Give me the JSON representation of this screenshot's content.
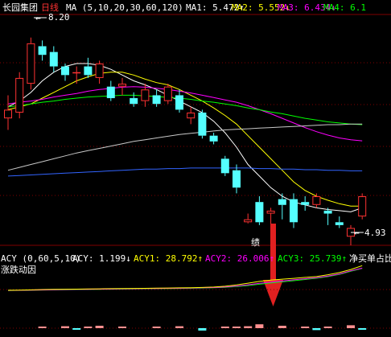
{
  "stock_name": "长园集团",
  "period": "日线",
  "main": {
    "indicator": "MA (5,10,20,30,60,120)",
    "ma_items": [
      {
        "label": "MA1:",
        "value": "5.472",
        "arrow": "↑",
        "color": "#ffffff"
      },
      {
        "label": "MA2:",
        "value": "5.552",
        "arrow": "↓",
        "color": "#ffff00"
      },
      {
        "label": "MA3:",
        "value": "6.434",
        "arrow": "↓",
        "color": "#ff00ff"
      },
      {
        "label": "MA4:",
        "value": "6.1",
        "arrow": "",
        "color": "#00ff00"
      }
    ],
    "high_label": "8.20",
    "low_label": "4.93"
  },
  "sub": {
    "indicator": "ACY (0,60,5,10)",
    "acy_items": [
      {
        "label": "ACY:",
        "value": "1.199",
        "arrow": "↓",
        "color": "#ffffff"
      },
      {
        "label": "ACY1:",
        "value": "28.792",
        "arrow": "↑",
        "color": "#ffff00"
      },
      {
        "label": "ACY2:",
        "value": "26.006",
        "arrow": "↑",
        "color": "#ff00ff"
      },
      {
        "label": "ACY3:",
        "value": "25.739",
        "arrow": "↑",
        "color": "#00ff00"
      }
    ],
    "extra_label": "净买单占比",
    "second_line": "涨跌动因"
  },
  "annotation": "绩",
  "colors": {
    "up": "#ff3232",
    "down": "#54ffff",
    "grid": "#800000",
    "ma5": "#ffffff",
    "ma10": "#ffff00",
    "ma20": "#ff00ff",
    "ma30": "#00ff00",
    "ma60": "#c8c8c8",
    "ma120": "#3264ff",
    "arrow": "#e02020"
  },
  "chart_data": {
    "type": "candlestick",
    "price_range": [
      4.6,
      8.6
    ],
    "candles": [
      {
        "o": 6.8,
        "h": 7.2,
        "l": 6.6,
        "c": 6.95
      },
      {
        "o": 6.9,
        "h": 7.6,
        "l": 6.8,
        "c": 7.5
      },
      {
        "o": 7.4,
        "h": 8.2,
        "l": 7.3,
        "c": 8.1
      },
      {
        "o": 8.05,
        "h": 8.15,
        "l": 7.8,
        "c": 7.9
      },
      {
        "o": 7.95,
        "h": 8.05,
        "l": 7.6,
        "c": 7.7
      },
      {
        "o": 7.7,
        "h": 7.75,
        "l": 7.45,
        "c": 7.55
      },
      {
        "o": 7.6,
        "h": 7.7,
        "l": 7.4,
        "c": 7.6
      },
      {
        "o": 7.7,
        "h": 7.85,
        "l": 7.5,
        "c": 7.55
      },
      {
        "o": 7.5,
        "h": 7.8,
        "l": 7.4,
        "c": 7.75
      },
      {
        "o": 7.35,
        "h": 7.45,
        "l": 7.1,
        "c": 7.15
      },
      {
        "o": 7.35,
        "h": 7.5,
        "l": 7.2,
        "c": 7.4
      },
      {
        "o": 7.15,
        "h": 7.25,
        "l": 7.0,
        "c": 7.05
      },
      {
        "o": 7.1,
        "h": 7.4,
        "l": 7.0,
        "c": 7.3
      },
      {
        "o": 7.2,
        "h": 7.3,
        "l": 7.0,
        "c": 7.05
      },
      {
        "o": 7.1,
        "h": 7.4,
        "l": 7.05,
        "c": 7.35
      },
      {
        "o": 7.2,
        "h": 7.3,
        "l": 6.9,
        "c": 6.95
      },
      {
        "o": 6.8,
        "h": 7.0,
        "l": 6.7,
        "c": 6.9
      },
      {
        "o": 6.9,
        "h": 6.95,
        "l": 6.45,
        "c": 6.5
      },
      {
        "o": 6.5,
        "h": 6.55,
        "l": 6.35,
        "c": 6.4
      },
      {
        "o": 6.1,
        "h": 6.15,
        "l": 5.8,
        "c": 5.85
      },
      {
        "o": 5.9,
        "h": 6.0,
        "l": 5.5,
        "c": 5.6
      },
      {
        "o": 5.0,
        "h": 5.15,
        "l": 4.98,
        "c": 5.05
      },
      {
        "o": 5.35,
        "h": 5.45,
        "l": 4.95,
        "c": 5.0
      },
      {
        "o": 5.15,
        "h": 5.25,
        "l": 4.95,
        "c": 5.2
      },
      {
        "o": 5.4,
        "h": 5.5,
        "l": 5.05,
        "c": 5.3
      },
      {
        "o": 5.4,
        "h": 5.5,
        "l": 4.9,
        "c": 5.0
      },
      {
        "o": 5.35,
        "h": 5.45,
        "l": 5.2,
        "c": 5.3
      },
      {
        "o": 5.3,
        "h": 5.5,
        "l": 5.25,
        "c": 5.45
      },
      {
        "o": 5.2,
        "h": 5.25,
        "l": 4.95,
        "c": 5.15
      },
      {
        "o": 5.0,
        "h": 5.1,
        "l": 4.9,
        "c": 4.95
      },
      {
        "o": 4.75,
        "h": 4.95,
        "l": 4.6,
        "c": 4.9
      },
      {
        "o": 5.1,
        "h": 5.5,
        "l": 5.05,
        "c": 5.45
      }
    ],
    "ma": {
      "ma5": [
        7.0,
        7.1,
        7.25,
        7.45,
        7.6,
        7.7,
        7.75,
        7.75,
        7.72,
        7.65,
        7.55,
        7.45,
        7.38,
        7.3,
        7.2,
        7.1,
        7.0,
        6.9,
        6.75,
        6.55,
        6.3,
        6.0,
        5.8,
        5.6,
        5.45,
        5.35,
        5.3,
        5.25,
        5.22,
        5.2,
        5.18,
        5.25
      ],
      "ma10": [
        6.95,
        7.0,
        7.05,
        7.15,
        7.25,
        7.35,
        7.45,
        7.52,
        7.58,
        7.6,
        7.6,
        7.55,
        7.48,
        7.42,
        7.38,
        7.3,
        7.2,
        7.1,
        6.98,
        6.85,
        6.7,
        6.5,
        6.3,
        6.1,
        5.9,
        5.7,
        5.55,
        5.45,
        5.38,
        5.32,
        5.28,
        5.28
      ],
      "ma20": [
        7.05,
        7.08,
        7.1,
        7.13,
        7.17,
        7.2,
        7.23,
        7.27,
        7.3,
        7.32,
        7.34,
        7.35,
        7.34,
        7.32,
        7.3,
        7.27,
        7.24,
        7.2,
        7.16,
        7.12,
        7.08,
        7.02,
        6.95,
        6.88,
        6.8,
        6.72,
        6.64,
        6.57,
        6.51,
        6.46,
        6.43,
        6.41
      ],
      "ma30": [
        7.0,
        7.02,
        7.05,
        7.08,
        7.1,
        7.13,
        7.15,
        7.17,
        7.18,
        7.19,
        7.2,
        7.2,
        7.19,
        7.18,
        7.16,
        7.15,
        7.13,
        7.1,
        7.08,
        7.05,
        7.02,
        6.98,
        6.95,
        6.91,
        6.88,
        6.84,
        6.8,
        6.77,
        6.74,
        6.72,
        6.7,
        6.69
      ],
      "ma60": [
        5.9,
        5.95,
        6.0,
        6.05,
        6.1,
        6.15,
        6.2,
        6.24,
        6.28,
        6.32,
        6.36,
        6.4,
        6.43,
        6.46,
        6.49,
        6.52,
        6.54,
        6.56,
        6.58,
        6.6,
        6.61,
        6.62,
        6.63,
        6.64,
        6.65,
        6.66,
        6.67,
        6.68,
        6.69,
        6.69,
        6.7,
        6.7
      ],
      "ma120": [
        5.8,
        5.81,
        5.82,
        5.83,
        5.84,
        5.85,
        5.86,
        5.87,
        5.88,
        5.89,
        5.9,
        5.91,
        5.92,
        5.92,
        5.93,
        5.93,
        5.94,
        5.94,
        5.94,
        5.94,
        5.94,
        5.94,
        5.93,
        5.93,
        5.92,
        5.92,
        5.91,
        5.91,
        5.9,
        5.9,
        5.89,
        5.89
      ]
    },
    "acy": {
      "acy1": [
        1.0,
        1.2,
        1.5,
        1.8,
        2.0,
        2.2,
        2.3,
        2.5,
        2.6,
        2.8,
        3.0,
        3.1,
        3.2,
        3.4,
        3.5,
        3.7,
        3.9,
        4.2,
        4.6,
        5.5,
        7.0,
        9.0,
        11.0,
        12.5,
        13.5,
        14.5,
        15.5,
        16.5,
        18.5,
        21.0,
        24.5,
        28.8
      ],
      "acy2": [
        0.8,
        1.0,
        1.2,
        1.4,
        1.6,
        1.8,
        2.0,
        2.1,
        2.3,
        2.4,
        2.6,
        2.7,
        2.9,
        3.0,
        3.2,
        3.3,
        3.5,
        3.8,
        4.1,
        4.8,
        5.8,
        7.2,
        8.8,
        10.2,
        11.5,
        12.8,
        14.0,
        15.2,
        17.0,
        19.5,
        23.0,
        26.0
      ],
      "acy3": [
        0.7,
        0.9,
        1.1,
        1.3,
        1.5,
        1.6,
        1.8,
        1.9,
        2.1,
        2.2,
        2.4,
        2.5,
        2.7,
        2.8,
        3.0,
        3.1,
        3.3,
        3.5,
        3.8,
        4.3,
        5.2,
        6.4,
        7.8,
        9.2,
        10.5,
        11.8,
        13.2,
        14.6,
        16.5,
        19.0,
        22.5,
        25.7
      ],
      "range": [
        0,
        40
      ]
    },
    "flow_bars": [
      0,
      0,
      0,
      0.3,
      0,
      0.4,
      -0.3,
      0.2,
      0.5,
      0,
      0.3,
      0,
      0,
      0.2,
      0,
      0.4,
      0,
      -0.5,
      0,
      0.3,
      0.2,
      0.4,
      0.8,
      0,
      0.5,
      0,
      0.2,
      -0.4,
      0.3,
      0,
      0.6,
      -0.3
    ]
  }
}
